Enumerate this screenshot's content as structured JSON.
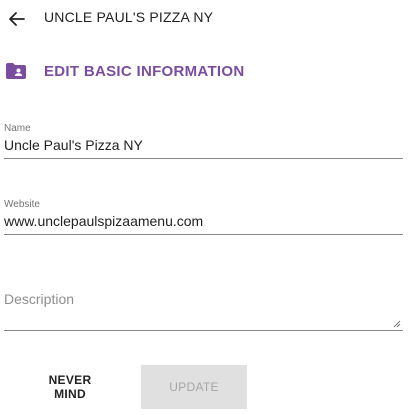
{
  "header": {
    "title": "UNCLE PAUL'S PIZZA NY",
    "back_icon": "arrow-left-icon"
  },
  "section": {
    "title": "EDIT BASIC INFORMATION",
    "icon": "contact-folder-icon",
    "accent_color": "#7b4d9e"
  },
  "form": {
    "name": {
      "label": "Name",
      "value": "Uncle Paul's Pizza NY"
    },
    "website": {
      "label": "Website",
      "value": "www.unclepaulspizaamenu.com"
    },
    "description": {
      "placeholder": "Description",
      "value": ""
    }
  },
  "actions": {
    "cancel_label": "NEVER MIND",
    "update_label": "UPDATE",
    "update_disabled": true
  }
}
